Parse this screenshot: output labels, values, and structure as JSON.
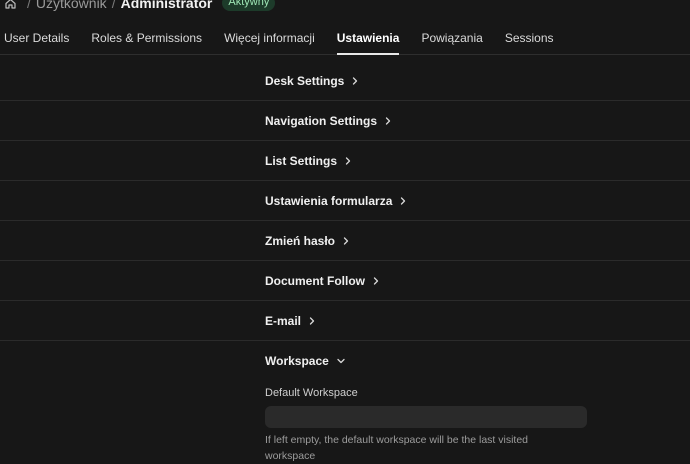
{
  "breadcrumb": {
    "home_icon": "home-icon",
    "items": [
      "Użytkownik",
      "Administrator"
    ],
    "separator": "/",
    "status_badge": "Aktywny"
  },
  "tabs": [
    {
      "label": "User Details",
      "active": false
    },
    {
      "label": "Roles & Permissions",
      "active": false
    },
    {
      "label": "Więcej informacji",
      "active": false
    },
    {
      "label": "Ustawienia",
      "active": true
    },
    {
      "label": "Powiązania",
      "active": false
    },
    {
      "label": "Sessions",
      "active": false
    }
  ],
  "sections": [
    {
      "title": "Desk Settings",
      "icon": "chevron-right-icon"
    },
    {
      "title": "Navigation Settings",
      "icon": "chevron-right-icon"
    },
    {
      "title": "List Settings",
      "icon": "chevron-right-icon"
    },
    {
      "title": "Ustawienia formularza",
      "icon": "chevron-right-icon"
    },
    {
      "title": "Zmień hasło",
      "icon": "chevron-right-icon"
    },
    {
      "title": "Document Follow",
      "icon": "chevron-right-icon"
    },
    {
      "title": "E-mail",
      "icon": "chevron-right-icon"
    }
  ],
  "workspace": {
    "title": "Workspace",
    "icon": "chevron-down-icon",
    "field_label": "Default Workspace",
    "field_value": "",
    "help_text": "If left empty, the default workspace will be the last visited workspace"
  },
  "colors": {
    "background": "#171717",
    "badge_bg": "#1d3b2a",
    "badge_text": "#9ee6b5",
    "input_bg": "#2a2a2a"
  }
}
